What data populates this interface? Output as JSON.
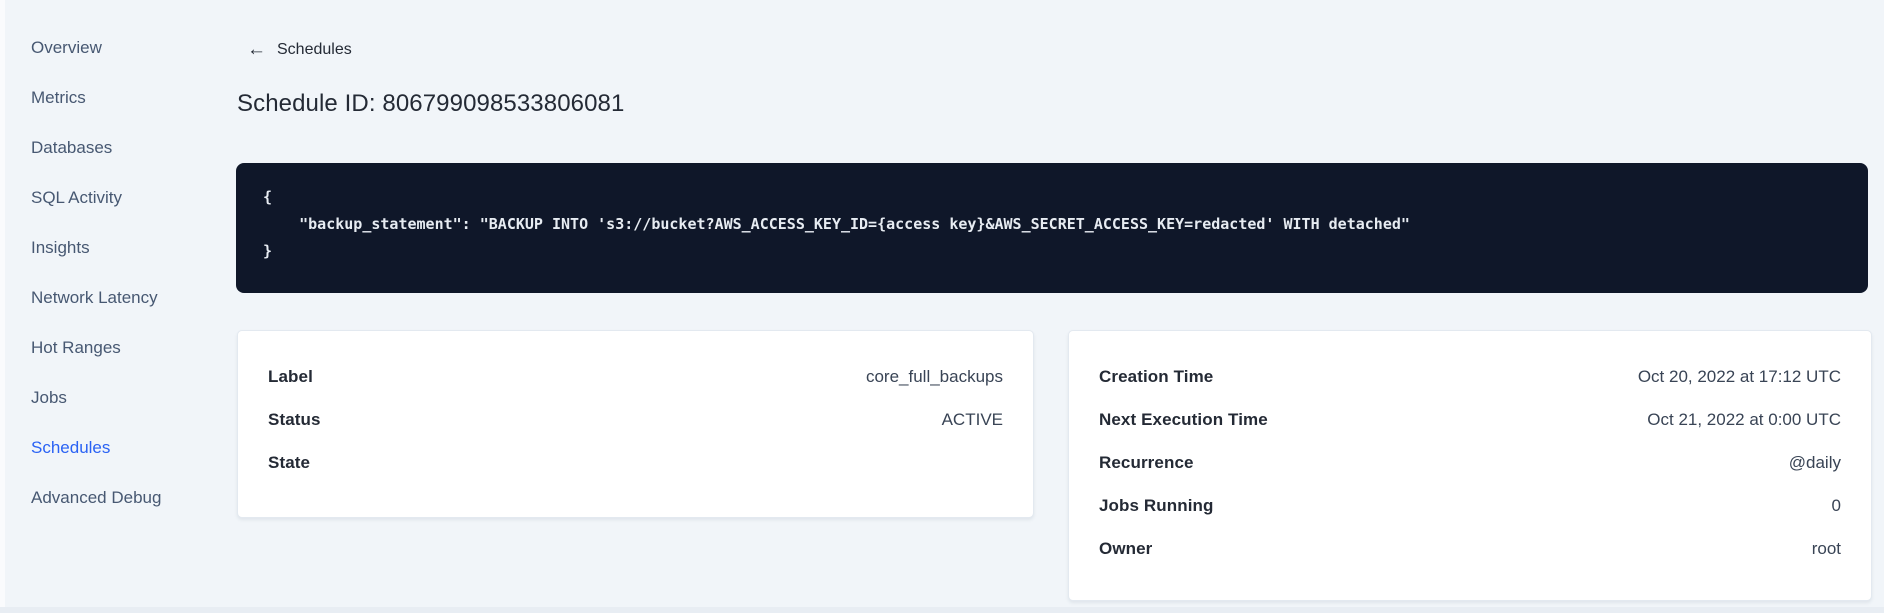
{
  "sidebar": {
    "items": [
      {
        "label": "Overview",
        "active": false
      },
      {
        "label": "Metrics",
        "active": false
      },
      {
        "label": "Databases",
        "active": false
      },
      {
        "label": "SQL Activity",
        "active": false
      },
      {
        "label": "Insights",
        "active": false
      },
      {
        "label": "Network Latency",
        "active": false
      },
      {
        "label": "Hot Ranges",
        "active": false
      },
      {
        "label": "Jobs",
        "active": false
      },
      {
        "label": "Schedules",
        "active": true
      },
      {
        "label": "Advanced Debug",
        "active": false
      }
    ]
  },
  "header": {
    "back_arrow": "←",
    "back_label": "Schedules",
    "title": "Schedule ID: 806799098533806081"
  },
  "code_block": {
    "lines": [
      "{",
      "    \"backup_statement\": \"BACKUP INTO 's3://bucket?AWS_ACCESS_KEY_ID={access key}&AWS_SECRET_ACCESS_KEY=redacted' WITH detached\"",
      "}"
    ]
  },
  "details_card": {
    "rows": [
      {
        "label": "Label",
        "value": "core_full_backups"
      },
      {
        "label": "Status",
        "value": "ACTIVE"
      },
      {
        "label": "State",
        "value": ""
      }
    ]
  },
  "schedule_card": {
    "rows": [
      {
        "label": "Creation Time",
        "value": "Oct 20, 2022 at 17:12 UTC"
      },
      {
        "label": "Next Execution Time",
        "value": "Oct 21, 2022 at 0:00 UTC"
      },
      {
        "label": "Recurrence",
        "value": "@daily"
      },
      {
        "label": "Jobs Running",
        "value": "0"
      },
      {
        "label": "Owner",
        "value": "root"
      }
    ]
  },
  "colors": {
    "accent_blue": "#2A62F4",
    "page_bg": "#F1F5F9",
    "sidebar_text": "#475872",
    "heading_text": "#242A35",
    "code_bg": "#0F1729",
    "code_text": "#E7ECF2",
    "card_border": "#E3E9F0",
    "value_text": "#394455",
    "bottom_strip": "#E8EDF3"
  }
}
